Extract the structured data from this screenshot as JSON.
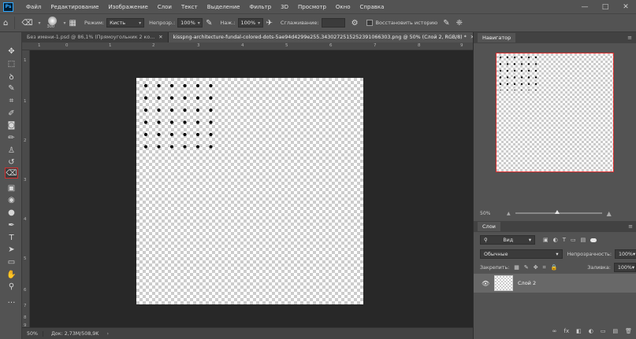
{
  "app": {
    "logo": "Ps"
  },
  "menu": [
    "Файл",
    "Редактирование",
    "Изображение",
    "Слои",
    "Текст",
    "Выделение",
    "Фильтр",
    "3D",
    "Просмотр",
    "Окно",
    "Справка"
  ],
  "window_controls": {
    "minimize": "—",
    "maximize": "□",
    "close": "✕"
  },
  "options": {
    "brush_size": "300",
    "mode_label": "Режим:",
    "mode_value": "Кисть",
    "opacity_label": "Непрозр.:",
    "opacity_value": "100%",
    "pressure_label": "Наж.:",
    "pressure_value": "100%",
    "smoothing_label": "Сглаживание:",
    "smoothing_value": "",
    "history_label": "Восстановить историю"
  },
  "tabs": [
    {
      "label": "Без имени-1.psd @ 86,1% (Прямоугольник 2 ко...",
      "close": "✕"
    },
    {
      "label": "kisspng-architecture-fundal-colored-dots-5ae94d4299e255.3430272515252391066303.png @ 50% (Слой 2, RGB/8) *",
      "close": "✕"
    }
  ],
  "toolbar": {
    "tools": [
      {
        "name": "move-tool",
        "icon": "✥"
      },
      {
        "name": "marquee-tool",
        "icon": "⬚"
      },
      {
        "name": "lasso-tool",
        "icon": "ꝺ"
      },
      {
        "name": "quick-select-tool",
        "icon": "✎"
      },
      {
        "name": "crop-tool",
        "icon": "⌗"
      },
      {
        "name": "eyedropper-tool",
        "icon": "✐"
      },
      {
        "name": "healing-tool",
        "icon": "◙"
      },
      {
        "name": "brush-tool",
        "icon": "✏"
      },
      {
        "name": "stamp-tool",
        "icon": "♙"
      },
      {
        "name": "history-brush-tool",
        "icon": "↺"
      },
      {
        "name": "eraser-tool",
        "icon": "⌫"
      },
      {
        "name": "gradient-tool",
        "icon": "▣"
      },
      {
        "name": "blur-tool",
        "icon": "◉"
      },
      {
        "name": "dodge-tool",
        "icon": "●"
      },
      {
        "name": "pen-tool",
        "icon": "✒"
      },
      {
        "name": "type-tool",
        "icon": "T"
      },
      {
        "name": "path-select-tool",
        "icon": "➤"
      },
      {
        "name": "shape-tool",
        "icon": "▭"
      },
      {
        "name": "hand-tool",
        "icon": "✋"
      },
      {
        "name": "zoom-tool",
        "icon": "⚲"
      },
      {
        "name": "more-tools",
        "icon": "…"
      }
    ],
    "selected": "eraser-tool"
  },
  "rulers": {
    "top": [
      "1",
      "0",
      "1",
      "2",
      "3",
      "4",
      "5",
      "6",
      "7",
      "8",
      "9"
    ],
    "left": [
      "1",
      "1",
      "2",
      "3",
      "4",
      "5",
      "6",
      "7",
      "8",
      "9"
    ]
  },
  "canvas": {
    "dots_cols": 6,
    "dots_rows": 6
  },
  "status": {
    "zoom": "50%",
    "doc_info": "Док: 2,73M/508,9K",
    "arrow": "›"
  },
  "navigator": {
    "tab": "Навигатор",
    "zoom": "50%",
    "menu": "≡"
  },
  "layers": {
    "tab": "Слои",
    "kind_label": "Вид",
    "blend_mode": "Обычные",
    "opacity_label": "Непрозрачность:",
    "opacity_value": "100%",
    "lock_label": "Закрепить:",
    "fill_label": "Заливка:",
    "fill_value": "100%",
    "layer_name": "Слой 2",
    "footer_icons": [
      "∞",
      "fx",
      "◧",
      "◐",
      "▭",
      "▤",
      "🗑"
    ]
  },
  "colors": {
    "selected_tool_border": "#d32f2f",
    "navigator_frame": "#e03030",
    "foreground": "#000000",
    "background": "#f0e1b8"
  }
}
